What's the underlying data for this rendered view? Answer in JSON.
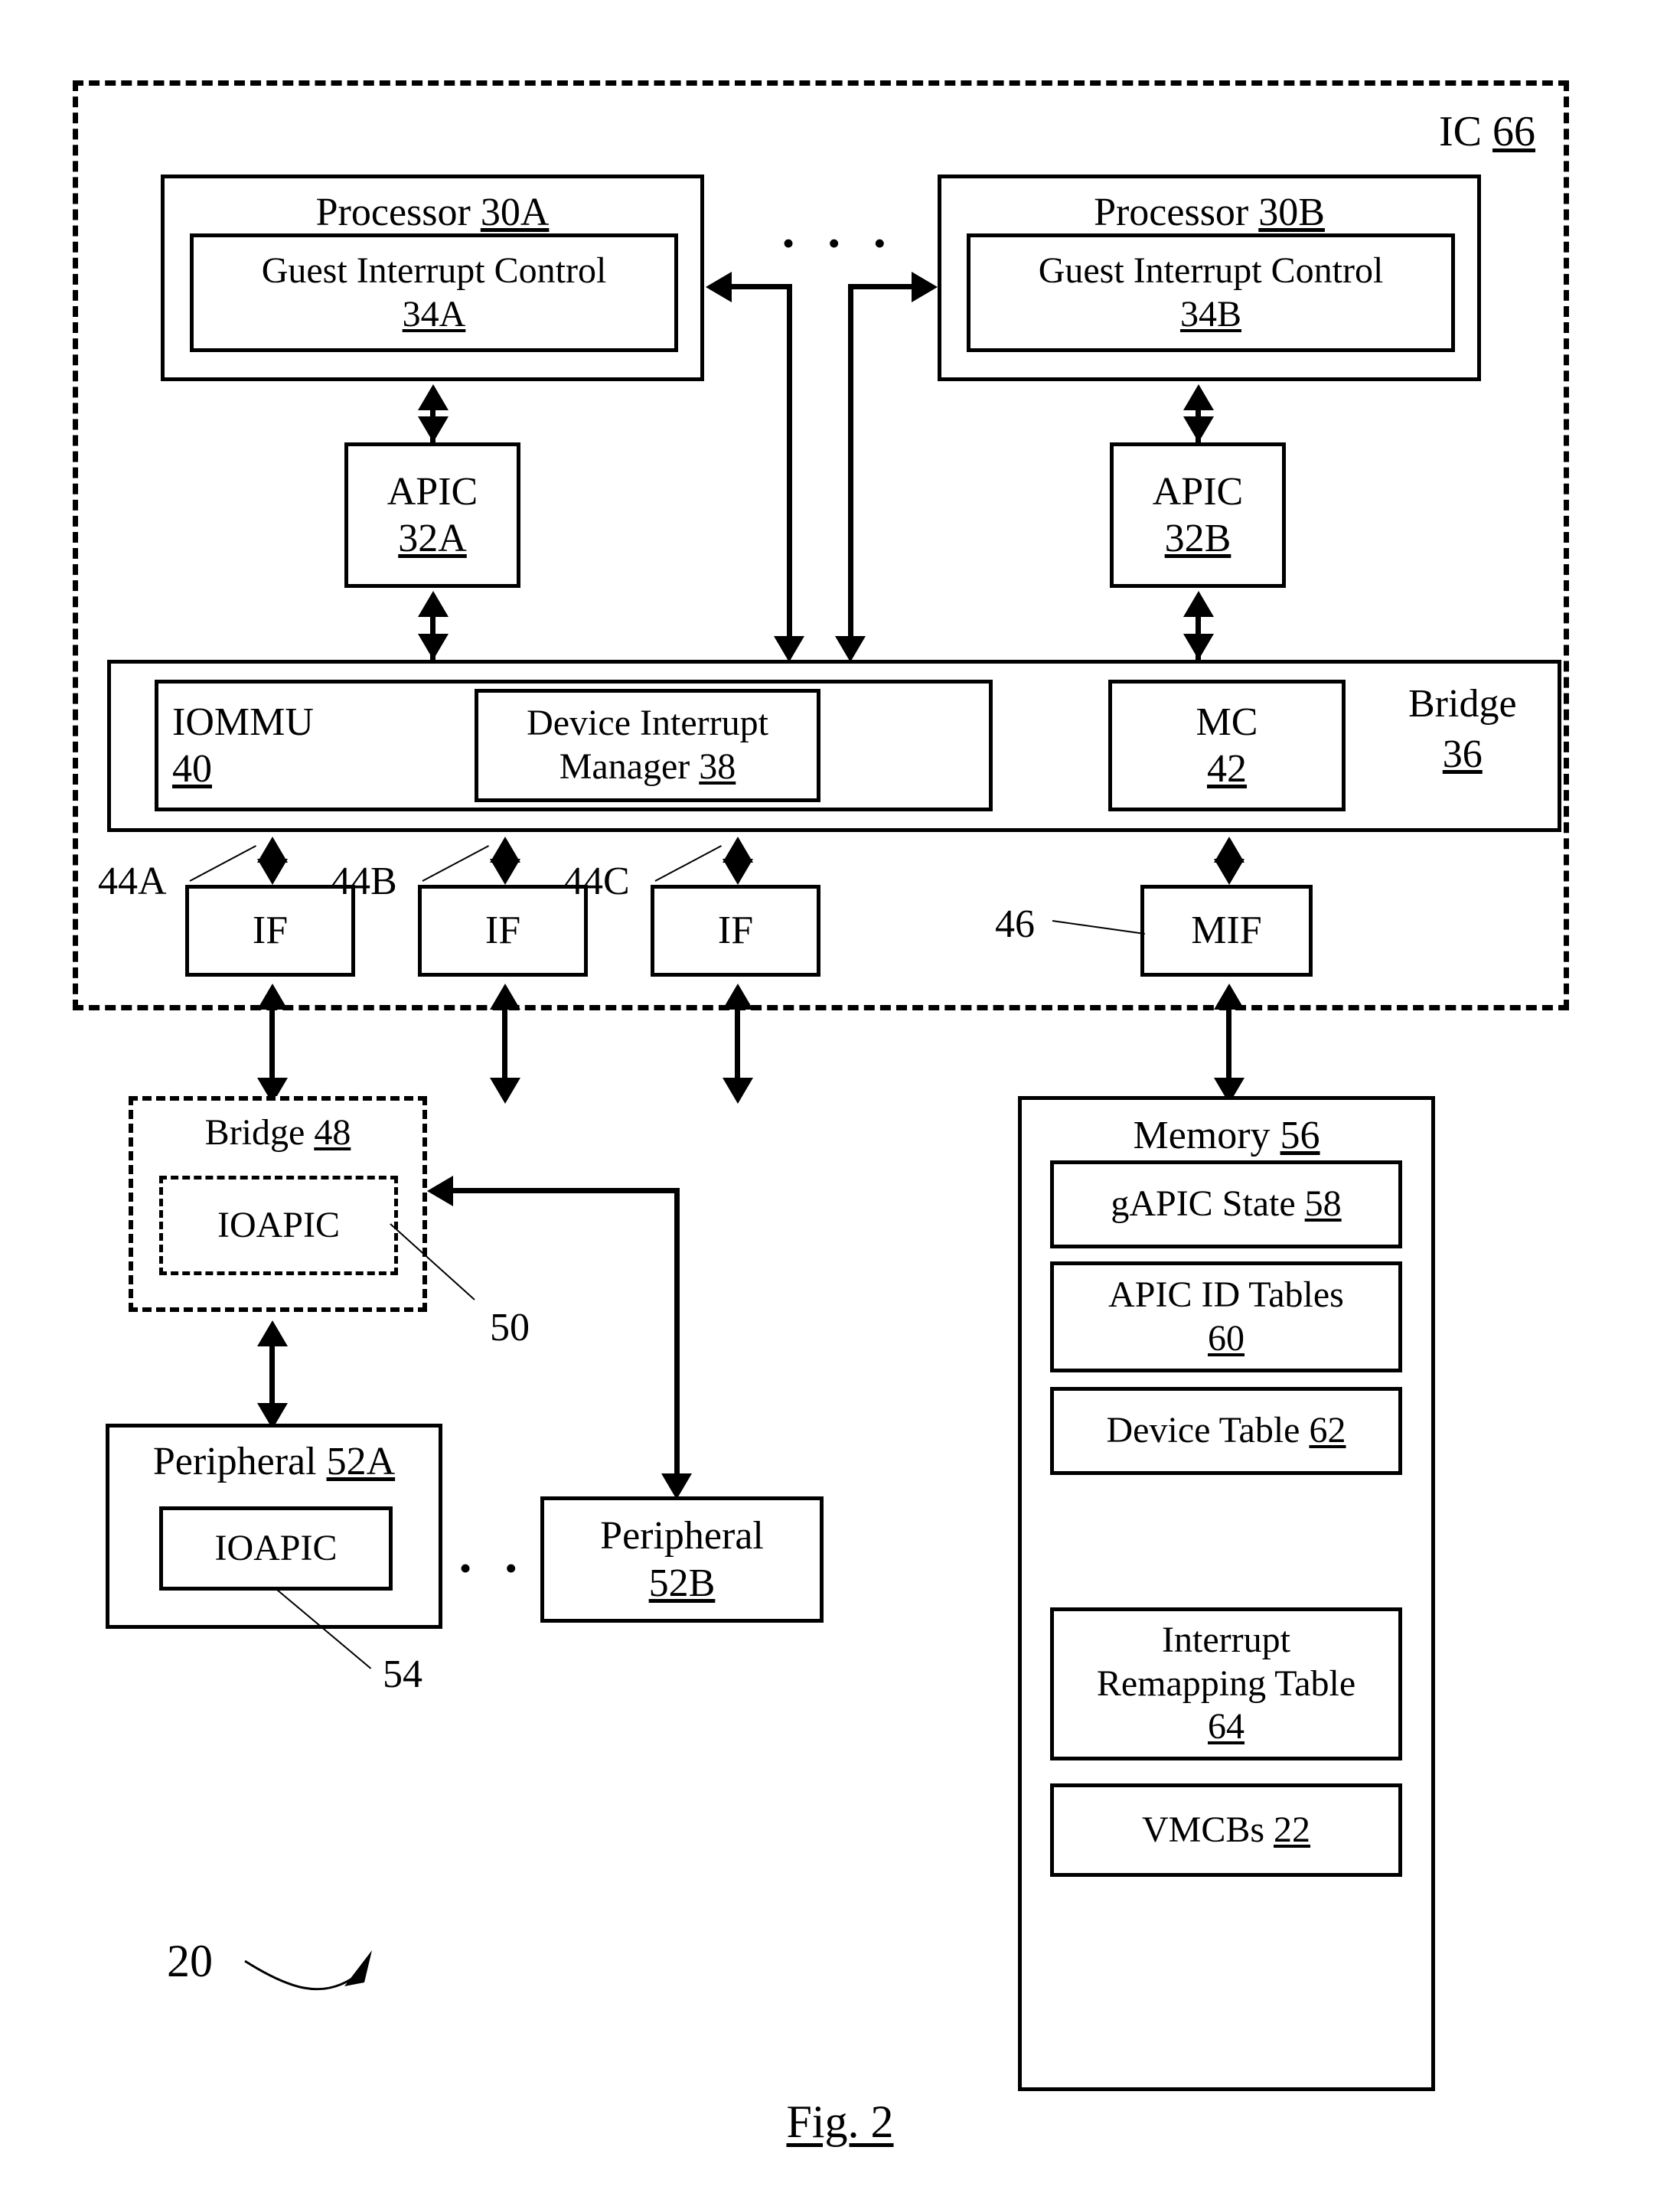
{
  "figure": {
    "caption": "Fig. 2",
    "system_ref": "20"
  },
  "ic": {
    "label": "IC",
    "ref": "66"
  },
  "processors": [
    {
      "name": "Processor",
      "ref": "30A",
      "inner": {
        "name": "Guest Interrupt Control",
        "ref": "34A"
      },
      "apic": {
        "name": "APIC",
        "ref": "32A"
      }
    },
    {
      "name": "Processor",
      "ref": "30B",
      "inner": {
        "name": "Guest Interrupt Control",
        "ref": "34B"
      },
      "apic": {
        "name": "APIC",
        "ref": "32B"
      }
    }
  ],
  "ellipsis": "•  •  •",
  "bridge36": {
    "name": "Bridge",
    "ref": "36",
    "iommu": {
      "name": "IOMMU",
      "ref": "40"
    },
    "device_interrupt_manager": {
      "name": "Device Interrupt",
      "name2": "Manager",
      "ref": "38"
    },
    "mc": {
      "name": "MC",
      "ref": "42"
    }
  },
  "interfaces": [
    {
      "label": "IF",
      "ref": "44A"
    },
    {
      "label": "IF",
      "ref": "44B"
    },
    {
      "label": "IF",
      "ref": "44C"
    }
  ],
  "memory_interface": {
    "label": "MIF",
    "ref": "46"
  },
  "bridge48": {
    "name": "Bridge",
    "ref": "48",
    "ioapic": {
      "label": "IOAPIC",
      "ref": "50"
    }
  },
  "peripherals": [
    {
      "name": "Peripheral",
      "ref": "52A",
      "ioapic": {
        "label": "IOAPIC",
        "ref": "54"
      }
    },
    {
      "name": "Peripheral",
      "ref": "52B"
    }
  ],
  "peripheral_ellipsis": "•  •  •",
  "memory": {
    "name": "Memory",
    "ref": "56",
    "items": [
      {
        "line1": "gAPIC State",
        "line2": "",
        "ref": "58",
        "ref_inline": true
      },
      {
        "line1": "APIC ID Tables",
        "line2": "",
        "ref": "60",
        "ref_inline": false
      },
      {
        "line1": "Device Table",
        "line2": "",
        "ref": "62",
        "ref_inline": true
      },
      {
        "line1": "Interrupt",
        "line2": "Remapping Table",
        "ref": "64",
        "ref_inline": false
      },
      {
        "line1": "VMCBs",
        "line2": "",
        "ref": "22",
        "ref_inline": true
      }
    ]
  }
}
